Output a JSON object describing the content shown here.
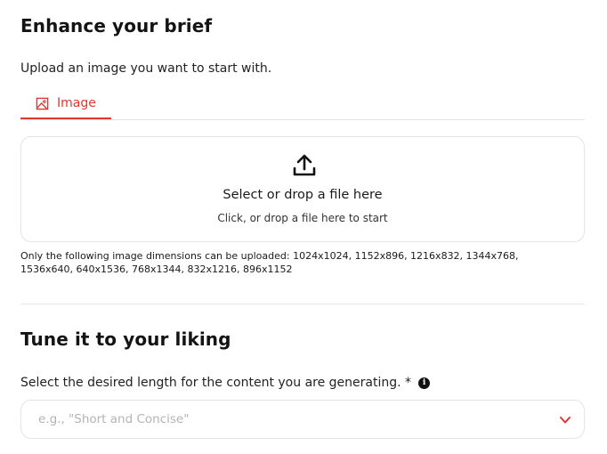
{
  "section1": {
    "title": "Enhance your brief",
    "subtitle": "Upload an image you want to start with.",
    "tabs": [
      {
        "label": "Image",
        "icon": "image-icon",
        "active": true
      }
    ],
    "dropzone": {
      "icon": "upload-icon",
      "title": "Select or drop a file here",
      "subtitle": "Click, or drop a file here to start"
    },
    "dimensions_note": "Only the following image dimensions can be uploaded: 1024x1024, 1152x896, 1216x832, 1344x768, 1536x640, 640x1536, 768x1344, 832x1216, 896x1152"
  },
  "section2": {
    "title": "Tune it to your liking",
    "length_label": "Select the desired length for the content you are generating. *",
    "info_icon": "info-icon",
    "select": {
      "placeholder": "e.g., \"Short and Concise\"",
      "icon": "chevron-down-icon"
    }
  },
  "colors": {
    "accent": "#e0382e",
    "border": "#e4e4e4",
    "placeholder": "#b4b4b4"
  }
}
